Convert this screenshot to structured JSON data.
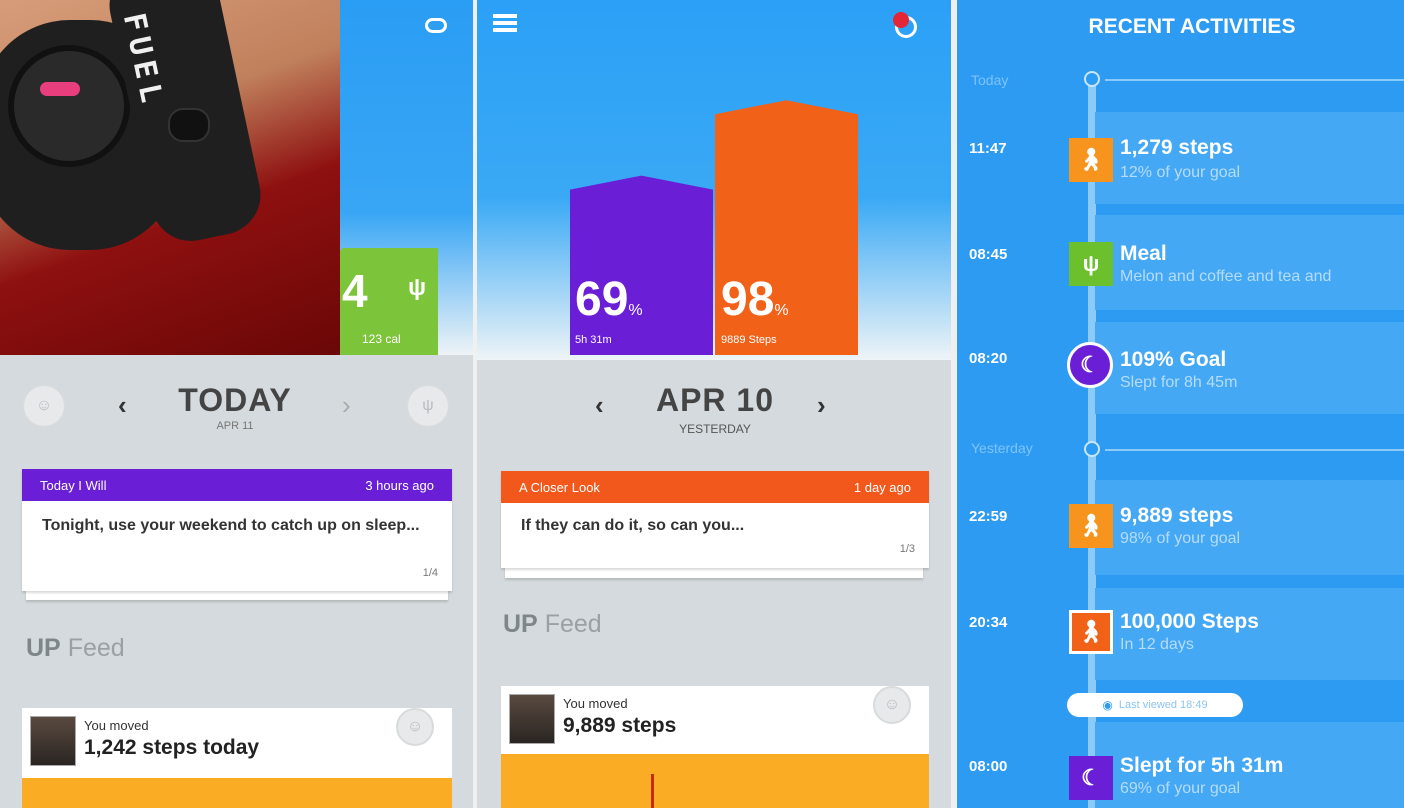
{
  "panel1": {
    "photo_band_text": "FUEL",
    "tile_value": "4",
    "tile_icon": "fork-knife-icon",
    "tile_cal": "123 cal",
    "day_title": "TODAY",
    "day_date": "APR 11",
    "card": {
      "head_left": "Today I Will",
      "head_right": "3 hours ago",
      "body": "Tonight, use your weekend to catch up on sleep...",
      "page": "1/4",
      "color": "#6a1fd6"
    },
    "feed_up": "UP",
    "feed_label": "Feed",
    "feed_card": {
      "line1": "You moved",
      "line2": "1,242 steps today"
    }
  },
  "panel2": {
    "bar1": {
      "pct": "69",
      "unit": "%",
      "sub": "5h 31m",
      "color": "#6a1fd6",
      "value": 69
    },
    "bar2": {
      "pct": "98",
      "unit": "%",
      "sub": "9889 Steps",
      "color": "#f26118",
      "value": 98
    },
    "day_title": "APR 10",
    "day_sub": "YESTERDAY",
    "card": {
      "head_left": "A Closer Look",
      "head_right": "1 day ago",
      "body": "If they can do it, so can you...",
      "page": "1/3",
      "color": "#f2581c"
    },
    "feed_up": "UP",
    "feed_label": "Feed",
    "feed_card": {
      "line1": "You moved",
      "line2": "9,889 steps"
    }
  },
  "panel3": {
    "title": "RECENT ACTIVITIES",
    "today_label": "Today",
    "yesterday_label": "Yesterday",
    "last_viewed": "Last viewed 18:49",
    "activities": [
      {
        "time": "11:47",
        "title": "1,279 steps",
        "sub": "12% of your goal",
        "icon": "walking-icon",
        "color": "#f7941d"
      },
      {
        "time": "08:45",
        "title": "Meal",
        "sub": "Melon and coffee and tea and",
        "icon": "fork-knife-icon",
        "color": "#6cc02e"
      },
      {
        "time": "08:20",
        "title": "109% Goal",
        "sub": "Slept for 8h 45m",
        "icon": "moon-icon",
        "color": "#6a1fd6"
      },
      {
        "time": "22:59",
        "title": "9,889 steps",
        "sub": "98% of your goal",
        "icon": "walking-icon",
        "color": "#f7941d"
      },
      {
        "time": "20:34",
        "title": "100,000 Steps",
        "sub": "In 12 days",
        "icon": "badge-icon",
        "color": "#f26118"
      },
      {
        "time": "08:00",
        "title": "Slept for 5h 31m",
        "sub": "69% of your goal",
        "icon": "moon-icon",
        "color": "#6a1fd6"
      }
    ]
  }
}
